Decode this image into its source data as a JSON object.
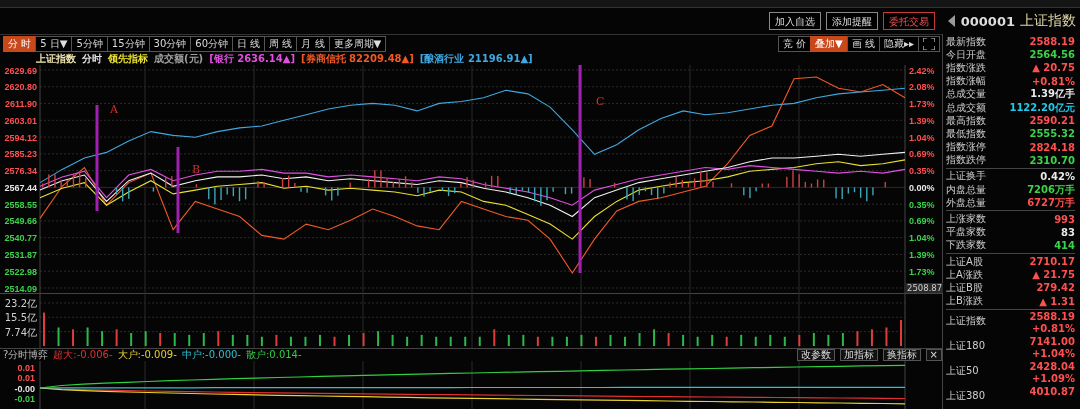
{
  "header": {
    "buttons": [
      {
        "label": "加入自选",
        "kind": "normal"
      },
      {
        "label": "添加提醒",
        "kind": "normal"
      },
      {
        "label": "委托交易",
        "kind": "trade"
      }
    ],
    "code": "000001",
    "name": "上证指数"
  },
  "period_tabs": [
    {
      "label": "分 时",
      "selected": true
    },
    {
      "label": "5 日▼",
      "selected": false
    },
    {
      "label": "5分钟",
      "selected": false
    },
    {
      "label": "15分钟",
      "selected": false
    },
    {
      "label": "30分钟",
      "selected": false
    },
    {
      "label": "60分钟",
      "selected": false
    },
    {
      "label": "日 线",
      "selected": false
    },
    {
      "label": "周 线",
      "selected": false
    },
    {
      "label": "月 线",
      "selected": false
    },
    {
      "label": "更多周期▼",
      "selected": false
    }
  ],
  "tools": [
    {
      "label": "竞 价",
      "selected": false
    },
    {
      "label": "叠加▼",
      "selected": true
    },
    {
      "label": "画 线",
      "selected": false
    },
    {
      "label": "隐藏▸▸",
      "selected": false
    }
  ],
  "legend": [
    {
      "text": "上证指数",
      "color": "#f0e6b0"
    },
    {
      "text": "分时",
      "color": "#e0e0e0"
    },
    {
      "text": "领先指标",
      "color": "#e8e030"
    },
    {
      "text": "成交额(元)",
      "color": "#a0a0a0"
    },
    {
      "text": "[银行 2636.14▲]",
      "color": "#e050e0"
    },
    {
      "text": "[券商信托 82209.48▲]",
      "color": "#f05a28"
    },
    {
      "text": "[酿酒行业 21196.91▲]",
      "color": "#40a8e0"
    }
  ],
  "main_chart": {
    "percent_axis": [
      {
        "label": "2.42%",
        "color": "#ff5050"
      },
      {
        "label": "2.08%",
        "color": "#ff5050"
      },
      {
        "label": "1.73%",
        "color": "#ff5050"
      },
      {
        "label": "1.39%",
        "color": "#ff5050"
      },
      {
        "label": "1.04%",
        "color": "#ff5050"
      },
      {
        "label": "0.69%",
        "color": "#ff5050"
      },
      {
        "label": "0.35%",
        "color": "#ff5050"
      },
      {
        "label": "0.00%",
        "color": "#e8e8e8"
      },
      {
        "label": "0.35%",
        "color": "#3cd24a"
      },
      {
        "label": "0.69%",
        "color": "#3cd24a"
      },
      {
        "label": "1.04%",
        "color": "#3cd24a"
      },
      {
        "label": "1.39%",
        "color": "#3cd24a"
      },
      {
        "label": "1.73%",
        "color": "#3cd24a"
      }
    ],
    "low_readout": "2508.87",
    "chart_data": {
      "type": "line",
      "grid": true,
      "ylim": [
        2514.09,
        2629.69
      ],
      "yticks": [
        {
          "value": 2629.69,
          "label": "2629.69"
        },
        {
          "value": 2620.8,
          "label": "2620.80"
        },
        {
          "value": 2611.9,
          "label": "2611.90"
        },
        {
          "value": 2603.01,
          "label": "2603.01"
        },
        {
          "value": 2594.12,
          "label": "2594.12"
        },
        {
          "value": 2585.23,
          "label": "2585.23"
        },
        {
          "value": 2576.34,
          "label": "2576.34"
        },
        {
          "value": 2567.44,
          "label": "2567.44"
        },
        {
          "value": 2558.55,
          "label": "2558.55"
        },
        {
          "value": 2549.66,
          "label": "2549.66"
        },
        {
          "value": 2540.77,
          "label": "2540.77"
        },
        {
          "value": 2531.87,
          "label": "2531.87"
        },
        {
          "value": 2522.98,
          "label": "2522.98"
        },
        {
          "value": 2514.09,
          "label": "2514.09"
        }
      ],
      "series": [
        {
          "color": "#40a8e0",
          "values": [
            2570,
            2577,
            2583,
            2586,
            2592,
            2597,
            2595,
            2594,
            2597,
            2599,
            2600,
            2603,
            2606,
            2609,
            2611,
            2612,
            2611,
            2608,
            2612,
            2613,
            2615,
            2619,
            2617,
            2610,
            2598,
            2585,
            2590,
            2598,
            2604,
            2608,
            2606,
            2607,
            2609,
            2611,
            2612,
            2615,
            2617,
            2618,
            2619,
            2620
          ]
        },
        {
          "color": "#f05a28",
          "values": [
            2551,
            2568,
            2578,
            2558,
            2570,
            2575,
            2545,
            2560,
            2556,
            2552,
            2542,
            2540,
            2548,
            2545,
            2550,
            2556,
            2552,
            2547,
            2545,
            2560,
            2556,
            2552,
            2550,
            2540,
            2522,
            2540,
            2555,
            2560,
            2562,
            2565,
            2568,
            2580,
            2595,
            2600,
            2625,
            2626,
            2620,
            2618,
            2622,
            2615
          ]
        },
        {
          "color": "#e8e030",
          "values": [
            2562,
            2567,
            2570,
            2558,
            2565,
            2571,
            2564,
            2566,
            2568,
            2569,
            2570,
            2567,
            2568,
            2566,
            2567,
            2566,
            2565,
            2563,
            2566,
            2565,
            2560,
            2558,
            2553,
            2548,
            2540,
            2552,
            2560,
            2566,
            2568,
            2570,
            2571,
            2573,
            2576,
            2577,
            2578,
            2580,
            2581,
            2579,
            2580,
            2582
          ]
        },
        {
          "color": "#e050e0",
          "values": [
            2568,
            2573,
            2576,
            2562,
            2574,
            2577,
            2571,
            2574,
            2576,
            2576,
            2577,
            2575,
            2575,
            2573,
            2574,
            2573,
            2572,
            2571,
            2573,
            2572,
            2569,
            2567,
            2565,
            2562,
            2558,
            2566,
            2569,
            2572,
            2574,
            2576,
            2578,
            2577,
            2579,
            2578,
            2577,
            2576,
            2575,
            2576,
            2575,
            2577
          ]
        },
        {
          "color": "#f0f0f0",
          "values": [
            2566,
            2571,
            2574,
            2560,
            2571,
            2575,
            2568,
            2571,
            2573,
            2573,
            2574,
            2572,
            2573,
            2571,
            2572,
            2571,
            2570,
            2569,
            2571,
            2570,
            2567,
            2565,
            2562,
            2558,
            2552,
            2562,
            2566,
            2570,
            2572,
            2574,
            2576,
            2578,
            2581,
            2583,
            2583,
            2584,
            2585,
            2584,
            2585,
            2586
          ]
        }
      ],
      "annotations": [
        {
          "text": "A"
        },
        {
          "text": "B"
        },
        {
          "text": "C"
        }
      ]
    }
  },
  "volume_chart": {
    "chart_data": {
      "type": "bar",
      "stacked": true,
      "grid": true,
      "ylim": [
        0,
        23.2
      ],
      "yticks": [
        {
          "value": 23.2,
          "label": "23.2亿"
        },
        {
          "value": 15.5,
          "label": "15.5亿"
        },
        {
          "value": 7.74,
          "label": "7.74亿"
        }
      ],
      "series": [
        {
          "color": "#e03c3c",
          "values": [
            18,
            null,
            9,
            null,
            null,
            9,
            null,
            null,
            7,
            null,
            null,
            null,
            8,
            null,
            null,
            null,
            6,
            null,
            null,
            null,
            5,
            null,
            7,
            null,
            null,
            null,
            null,
            null,
            null,
            null,
            null,
            9,
            null,
            null,
            5,
            null,
            null,
            null,
            5,
            null,
            null,
            null,
            null,
            7,
            null,
            null,
            null,
            5,
            null,
            null,
            null,
            null,
            6,
            null,
            null,
            null,
            8,
            9,
            10,
            14
          ]
        },
        {
          "color": "#2cb84a",
          "values": [
            null,
            10,
            null,
            10,
            8,
            null,
            7,
            8,
            null,
            7,
            6,
            7,
            null,
            6,
            6,
            5,
            null,
            5,
            5,
            6,
            null,
            6,
            null,
            8,
            6,
            5,
            6,
            5,
            5,
            5,
            5,
            null,
            6,
            6,
            null,
            5,
            5,
            6,
            null,
            6,
            5,
            7,
            9,
            null,
            6,
            5,
            6,
            null,
            6,
            5,
            6,
            5,
            null,
            7,
            6,
            7,
            null,
            null,
            null,
            null
          ]
        }
      ]
    }
  },
  "indicator": {
    "title": "?分时博弈",
    "readouts": [
      {
        "text": "超大:-0.006-",
        "color": "#e03030"
      },
      {
        "text": "大户:-0.009-",
        "color": "#e8d030"
      },
      {
        "text": "中户:-0.000-",
        "color": "#30c0d0"
      },
      {
        "text": "散户:0.014-",
        "color": "#30d040"
      }
    ],
    "buttons": [
      "改参数",
      "加指标",
      "换指标",
      "×"
    ],
    "axis_labels": [
      {
        "label": "0.01",
        "color": "#ff5050"
      },
      {
        "label": "0.01",
        "color": "#ff5050"
      },
      {
        "label": "-0.00",
        "color": "#e8e8e8"
      },
      {
        "label": "-0.01",
        "color": "#3cd24a"
      }
    ]
  },
  "quote_groups": [
    [
      {
        "label": "最新指数",
        "value": "2588.19",
        "color": "#ff5050"
      },
      {
        "label": "今日开盘",
        "value": "2564.56",
        "color": "#3cd24a"
      },
      {
        "label": "指数涨跌",
        "value": "▲ 20.75",
        "color": "#ff5050"
      },
      {
        "label": "指数涨幅",
        "value": "+0.81%",
        "color": "#ff5050"
      },
      {
        "label": "总成交量",
        "value": "1.39亿手",
        "color": "#e8e8e8"
      },
      {
        "label": "总成交额",
        "value": "1122.20亿元",
        "color": "#22c8e8"
      },
      {
        "label": "最高指数",
        "value": "2590.21",
        "color": "#ff5050"
      },
      {
        "label": "最低指数",
        "value": "2555.32",
        "color": "#3cd24a"
      },
      {
        "label": "指数涨停",
        "value": "2824.18",
        "color": "#ff5050"
      },
      {
        "label": "指数跌停",
        "value": "2310.70",
        "color": "#3cd24a"
      }
    ],
    [
      {
        "label": "上证换手",
        "value": "0.42%",
        "color": "#e8e8e8"
      },
      {
        "label": "内盘总量",
        "value": "7206万手",
        "color": "#3cd24a"
      },
      {
        "label": "外盘总量",
        "value": "6727万手",
        "color": "#ff5050"
      }
    ],
    [
      {
        "label": "上涨家数",
        "value": "993",
        "color": "#ff5050"
      },
      {
        "label": "平盘家数",
        "value": "83",
        "color": "#e8e8e8"
      },
      {
        "label": "下跌家数",
        "value": "414",
        "color": "#3cd24a"
      }
    ],
    [
      {
        "label": "上证A股",
        "value": "2710.17",
        "color": "#ff5050"
      },
      {
        "label": "上A涨跌",
        "value": "▲ 21.75",
        "color": "#ff5050"
      },
      {
        "label": "上证B股",
        "value": "279.42",
        "color": "#ff5050"
      },
      {
        "label": "上B涨跌",
        "value": "▲ 1.31",
        "color": "#ff5050"
      }
    ]
  ],
  "index_quotes": [
    {
      "name": "上证指数",
      "price": "2588.19",
      "change": "+0.81%",
      "color": "#ff5050"
    },
    {
      "name": "上证180",
      "price": "7141.00",
      "change": "+1.04%",
      "color": "#ff5050"
    },
    {
      "name": "上证50",
      "price": "2428.04",
      "change": "+1.09%",
      "color": "#ff5050"
    },
    {
      "name": "上证380",
      "price": "4010.87",
      "color": "#ff5050"
    }
  ]
}
